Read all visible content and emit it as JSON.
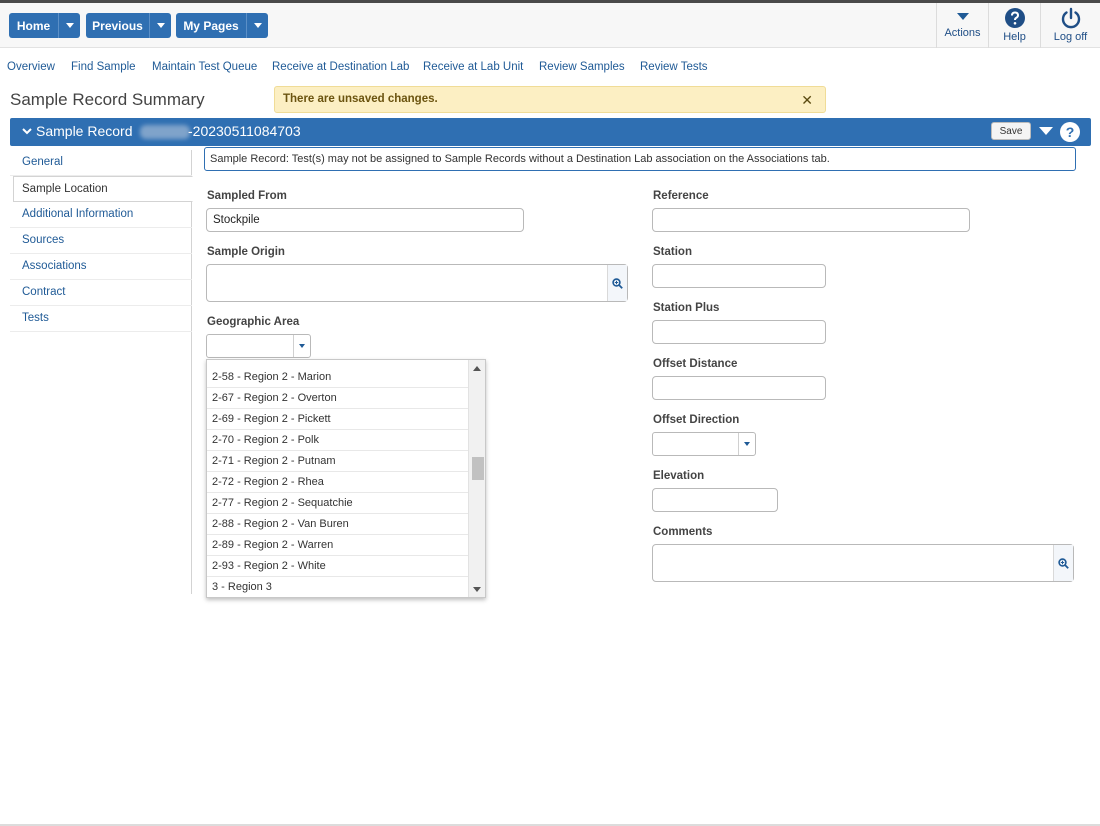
{
  "topbar": {
    "buttons": [
      {
        "label": "Home"
      },
      {
        "label": "Previous"
      },
      {
        "label": "My Pages"
      }
    ],
    "icons": [
      {
        "name": "actions-icon",
        "label": "Actions"
      },
      {
        "name": "help-icon",
        "label": "Help"
      },
      {
        "name": "log-off-icon",
        "label": "Log off"
      }
    ]
  },
  "nav": {
    "links": [
      "Overview",
      "Find Sample",
      "Maintain Test Queue",
      "Receive at Destination Lab",
      "Receive at Lab Unit",
      "Review Samples",
      "Review Tests"
    ]
  },
  "page": {
    "title": "Sample Record Summary",
    "unsaved_message": "There are unsaved changes.",
    "close_glyph": "✕"
  },
  "record": {
    "title_prefix": "Sample Record",
    "title_suffix": "-20230511084703",
    "save_label": "Save",
    "help_glyph": "?"
  },
  "sidenav": {
    "items": [
      "General",
      "Sample Location",
      "Additional Information",
      "Sources",
      "Associations",
      "Contract",
      "Tests"
    ],
    "active": "Sample Location"
  },
  "info_message": "Sample Record: Test(s) may not be assigned to Sample Records without a Destination Lab association on the Associations tab.",
  "form": {
    "sampled_from": {
      "label": "Sampled From",
      "value": "Stockpile"
    },
    "sample_origin": {
      "label": "Sample Origin",
      "value": ""
    },
    "geographic_area": {
      "label": "Geographic Area",
      "value": ""
    },
    "reference": {
      "label": "Reference",
      "value": ""
    },
    "station": {
      "label": "Station",
      "value": ""
    },
    "station_plus": {
      "label": "Station Plus",
      "value": ""
    },
    "offset_distance": {
      "label": "Offset Distance",
      "value": ""
    },
    "offset_direction": {
      "label": "Offset Direction",
      "value": ""
    },
    "elevation": {
      "label": "Elevation",
      "value": ""
    },
    "comments": {
      "label": "Comments",
      "value": ""
    }
  },
  "dropdown": {
    "options": [
      "2-58 - Region 2 - Marion",
      "2-67 - Region 2 - Overton",
      "2-69 - Region 2 - Pickett",
      "2-70 - Region 2 - Polk",
      "2-71 - Region 2 - Putnam",
      "2-72 - Region 2 - Rhea",
      "2-77 - Region 2 - Sequatchie",
      "2-88 - Region 2 - Van Buren",
      "2-89 - Region 2 - Warren",
      "2-93 - Region 2 - White",
      "3 - Region 3"
    ]
  },
  "colors": {
    "primary": "#2f6fb2",
    "link": "#1f5a96",
    "warning_bg": "#fcefc3"
  }
}
